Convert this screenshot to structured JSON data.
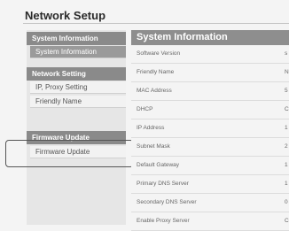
{
  "page_title": "Network Setup",
  "sidebar": {
    "sections": [
      {
        "header": "System Information",
        "items": [
          "System Information"
        ]
      },
      {
        "header": "Network Setting",
        "items": [
          "IP, Proxy Setting",
          "Friendly Name"
        ]
      },
      {
        "header": "Firmware Update",
        "items": [
          "Firmware Update"
        ]
      }
    ]
  },
  "main": {
    "header": "System Information",
    "rows": [
      {
        "label": "Software Version",
        "value": "s"
      },
      {
        "label": "Friendly Name",
        "value": "N"
      },
      {
        "label": "MAC Address",
        "value": "5"
      },
      {
        "label": "DHCP",
        "value": "C"
      },
      {
        "label": "IP Address",
        "value": "1"
      },
      {
        "label": "Subnet Mask",
        "value": "2"
      },
      {
        "label": "Default Gateway",
        "value": "1"
      },
      {
        "label": "Primary DNS Server",
        "value": "1"
      },
      {
        "label": "Secondary DNS Server",
        "value": "0"
      },
      {
        "label": "Enable Proxy Server",
        "value": "C"
      }
    ]
  }
}
